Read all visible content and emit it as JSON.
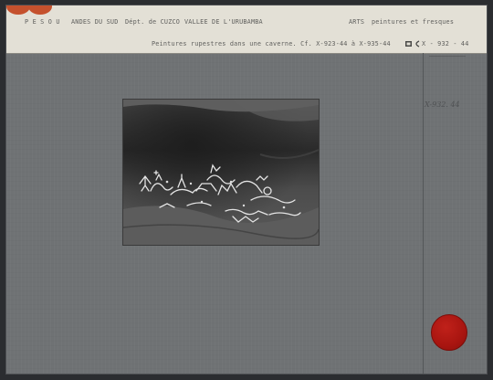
{
  "card": {
    "code": "P E S O U",
    "region": "ANDES DU SUD",
    "department": "Dépt. de CUZCO",
    "valley": "VALLEE DE L'URUBAMBA",
    "subject": "ARTS",
    "subject_detail": "peintures et fresques",
    "caption": "Peintures rupestres dans une caverne. Cf. X-923-44 à X-935-44",
    "reference": "X - 932 - 44",
    "handwritten_note": "X-932. 44"
  },
  "colors": {
    "card": "#6f7274",
    "header": "#e3e0d6",
    "punch_holes": "#c5512d",
    "seal": "#b0160f"
  }
}
